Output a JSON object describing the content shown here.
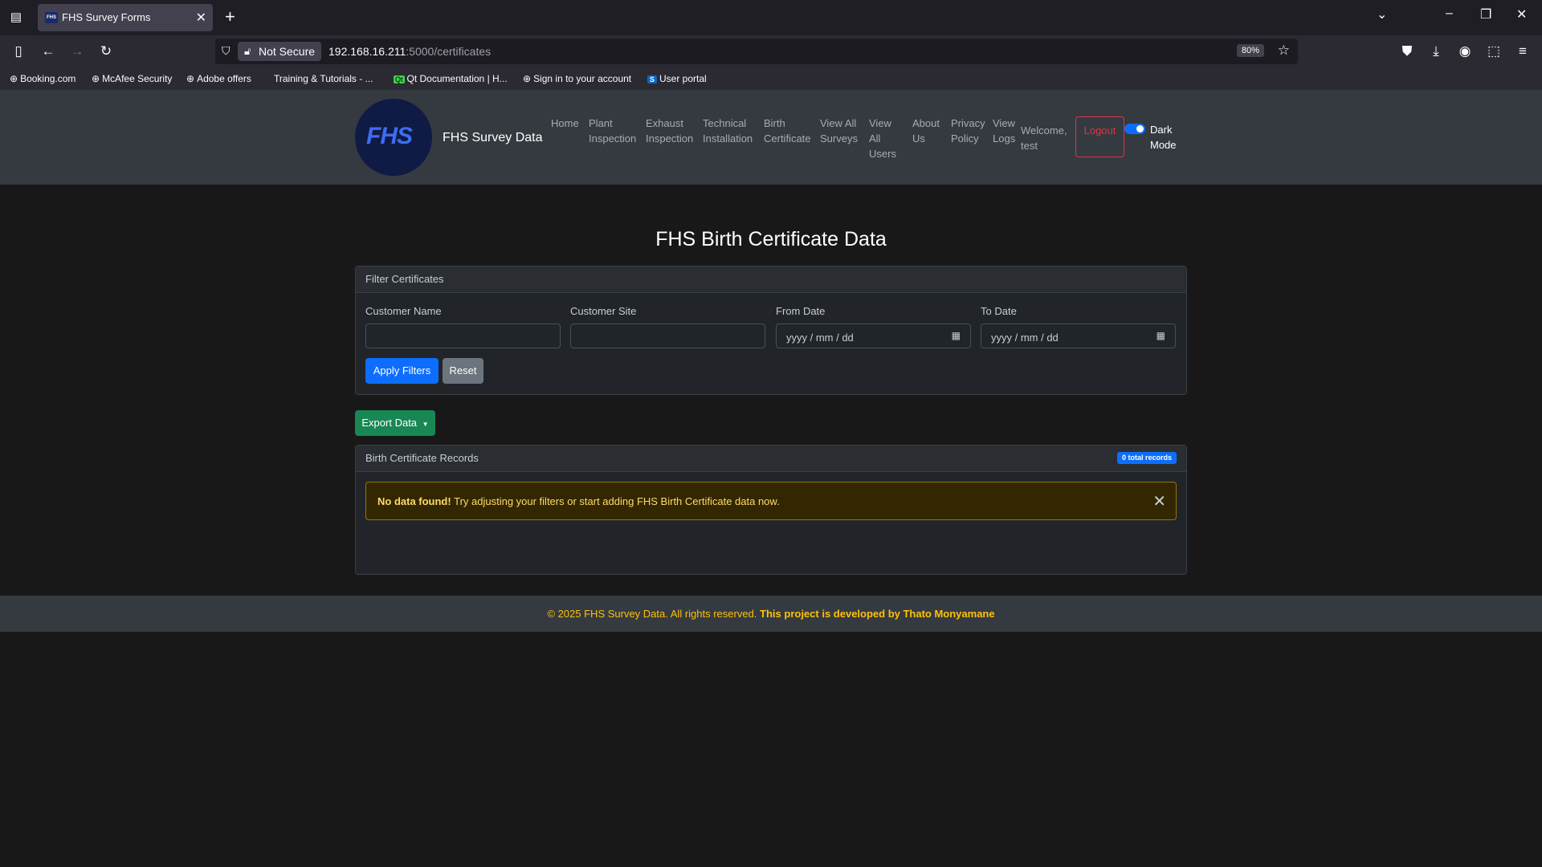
{
  "browser": {
    "tab_title": "FHS Survey Forms",
    "tab_favicon_text": "FHS",
    "not_secure": "Not Secure",
    "url_host": "192.168.16.211",
    "url_path": ":5000/certificates",
    "zoom": "80%",
    "bookmarks": [
      {
        "label": "Booking.com",
        "icon": "globe-icon"
      },
      {
        "label": "McAfee Security",
        "icon": "globe-icon"
      },
      {
        "label": "Adobe offers",
        "icon": "globe-icon"
      },
      {
        "label": "Training & Tutorials - ...",
        "icon": "training-icon"
      },
      {
        "label": "Qt Documentation | H...",
        "icon": "qt-icon"
      },
      {
        "label": "Sign in to your account",
        "icon": "globe-icon"
      },
      {
        "label": "User portal",
        "icon": "s-icon"
      }
    ]
  },
  "site": {
    "logo_text": "FHS",
    "brand": "FHS Survey Data",
    "nav": [
      {
        "label": "Home"
      },
      {
        "label": "Plant Inspection"
      },
      {
        "label": "Exhaust Inspection"
      },
      {
        "label": "Technical Installation"
      },
      {
        "label": "Birth Certificate"
      },
      {
        "label": "View All Surveys"
      },
      {
        "label": "View All Users"
      },
      {
        "label": "About Us"
      },
      {
        "label": "Privacy Policy"
      },
      {
        "label": "View Logs"
      }
    ],
    "welcome": "Welcome, test",
    "logout": "Logout",
    "dark_mode": "Dark Mode",
    "dark_mode_on": true
  },
  "main": {
    "title": "FHS Birth Certificate Data",
    "filter": {
      "header": "Filter Certificates",
      "customer_name_label": "Customer Name",
      "customer_name_value": "",
      "customer_site_label": "Customer Site",
      "customer_site_value": "",
      "from_date_label": "From Date",
      "from_date_placeholder": "yyyy / mm / dd",
      "to_date_label": "To Date",
      "to_date_placeholder": "yyyy / mm / dd",
      "apply_label": "Apply Filters",
      "reset_label": "Reset"
    },
    "export_label": "Export Data",
    "records": {
      "header": "Birth Certificate Records",
      "badge": "0 total records",
      "alert_bold": "No data found!",
      "alert_text": "Try adjusting your filters or start adding FHS Birth Certificate data now."
    }
  },
  "footer": {
    "copyright": "© 2025 FHS Survey Data. All rights reserved.",
    "credit": "This project is developed by Thato Monyamane"
  },
  "colors": {
    "primary": "#0d6efd",
    "success": "#198754",
    "danger": "#dc3545",
    "warning": "#ffc107",
    "navbar": "#343a40",
    "page_bg": "#181818"
  }
}
